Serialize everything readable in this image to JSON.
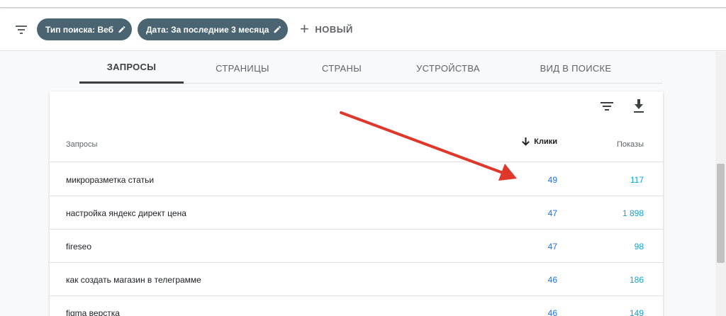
{
  "filters": {
    "chips": [
      {
        "label": "Тип поиска: Веб"
      },
      {
        "label": "Дата: За последние 3 месяца"
      }
    ],
    "new_label": "НОВЫЙ"
  },
  "tabs": [
    {
      "label": "ЗАПРОСЫ",
      "active": true
    },
    {
      "label": "СТРАНИЦЫ"
    },
    {
      "label": "СТРАНЫ"
    },
    {
      "label": "УСТРОЙСТВА"
    },
    {
      "label": "ВИД В ПОИСКЕ"
    }
  ],
  "table": {
    "columns": {
      "query": "Запросы",
      "clicks": "Клики",
      "shows": "Показы"
    },
    "rows": [
      {
        "query": "микроразметка статьи",
        "clicks": "49",
        "shows": "117"
      },
      {
        "query": "настройка яндекс директ цена",
        "clicks": "47",
        "shows": "1 898"
      },
      {
        "query": "fireseo",
        "clicks": "47",
        "shows": "98"
      },
      {
        "query": "как создать магазин в телеграмме",
        "clicks": "46",
        "shows": "186"
      },
      {
        "query": "figma верстка",
        "clicks": "46",
        "shows": "149"
      }
    ]
  },
  "colors": {
    "chip": "#4a6571",
    "clicks": "#1a73e8",
    "shows": "#12a4d9",
    "arrow": "#e0372b"
  }
}
